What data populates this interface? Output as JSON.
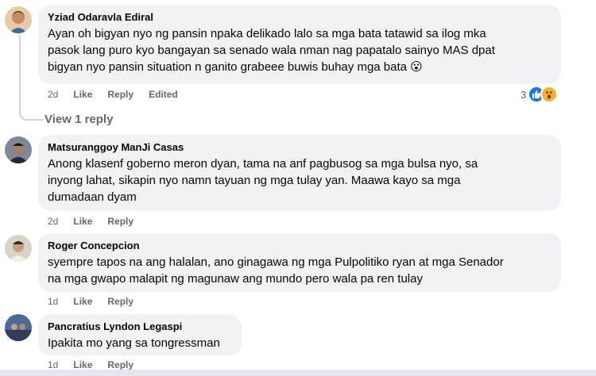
{
  "comments": [
    {
      "author": "Yziad Odaravla Ediral",
      "lines": [
        "Ayan oh bigyan nyo ng pansin npaka delikado lalo sa mga bata tatawid sa ilog mka",
        "pasok lang puro kyo bangayan sa senado wala nman nag papatalo sainyo MAS dpat",
        "bigyan nyo pansin situation n ganito grabeee buwis buhay mga bata"
      ],
      "emoji": "😮",
      "time": "2d",
      "like": "Like",
      "reply": "Reply",
      "edited": "Edited",
      "reaction_count": "3",
      "view_replies": "View 1 reply"
    },
    {
      "author": "Matsuranggoy ManJi Casas",
      "lines": [
        "Anong klasenf goberno meron dyan, tama na anf pagbusog sa mga bulsa nyo, sa",
        "inyong lahat, sikapin nyo namn tayuan ng mga tulay yan. Maawa kayo sa mga",
        "dumadaan dyam"
      ],
      "time": "2d",
      "like": "Like",
      "reply": "Reply"
    },
    {
      "author": "Roger Concepcion",
      "lines": [
        "syempre tapos na ang halalan, ano ginagawa ng mga Pulpolitiko ryan at mga Senador",
        "na mga gwapo malapit ng magunaw ang mundo pero wala pa ren tulay"
      ],
      "time": "1d",
      "like": "Like",
      "reply": "Reply"
    },
    {
      "author": "Pancratius Lyndon Legaspi",
      "lines": [
        "Ipakita mo yang sa tongressman"
      ],
      "time": "1d",
      "like": "Like",
      "reply": "Reply"
    }
  ],
  "colors": {
    "bubble": "#f0f2f5",
    "meta": "#65676b",
    "like_blue": "#1877f2",
    "wow_yellow": "#f7b125"
  },
  "icons": [
    "like-reaction-icon",
    "wow-reaction-icon"
  ]
}
